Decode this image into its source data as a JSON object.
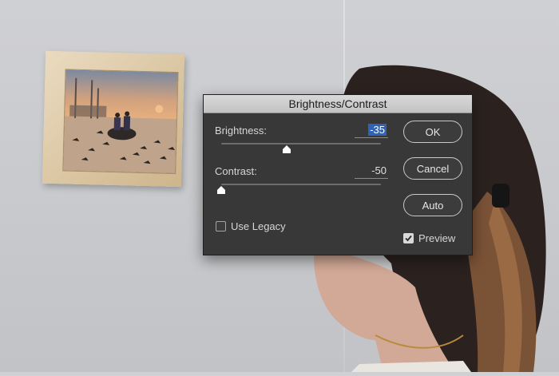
{
  "dialog": {
    "title": "Brightness/Contrast",
    "brightness": {
      "label": "Brightness:",
      "value": "-35",
      "level": 0.41
    },
    "contrast": {
      "label": "Contrast:",
      "value": "-50",
      "level": 0.0
    },
    "buttons": {
      "ok": "OK",
      "cancel": "Cancel",
      "auto": "Auto"
    },
    "use_legacy": {
      "label": "Use Legacy",
      "checked": false
    },
    "preview": {
      "label": "Preview",
      "checked": true
    }
  },
  "colors": {
    "dialog_bg": "#383838",
    "titlebar": "#c9c9c9",
    "selection": "#2f63b8"
  }
}
